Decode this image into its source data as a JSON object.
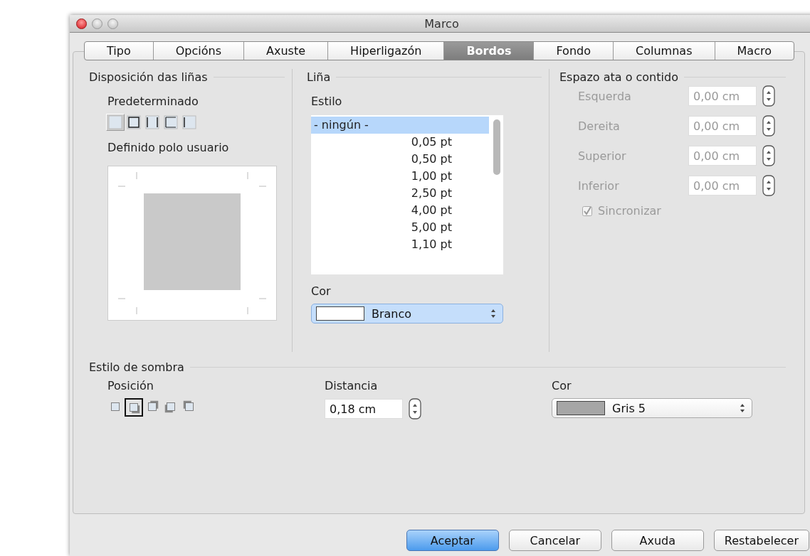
{
  "window": {
    "title": "Marco"
  },
  "tabs": [
    {
      "label": "Tipo",
      "selected": false
    },
    {
      "label": "Opcións",
      "selected": false
    },
    {
      "label": "Axuste",
      "selected": false
    },
    {
      "label": "Hiperligazón",
      "selected": false
    },
    {
      "label": "Bordos",
      "selected": true
    },
    {
      "label": "Fondo",
      "selected": false
    },
    {
      "label": "Columnas",
      "selected": false
    },
    {
      "label": "Macro",
      "selected": false
    }
  ],
  "line_arrangement": {
    "title": "Disposición das liñas",
    "default_label": "Predeterminado",
    "presets": [
      {
        "kind": "none",
        "selected": true
      },
      {
        "kind": "box",
        "selected": false
      },
      {
        "kind": "left-right",
        "selected": false
      },
      {
        "kind": "top-bottom",
        "selected": false
      },
      {
        "kind": "left",
        "selected": false
      }
    ],
    "user_label": "Definido polo usuario"
  },
  "line": {
    "title": "Liña",
    "style_label": "Estilo",
    "styles": [
      {
        "label": "- ningún -",
        "selected": true
      },
      {
        "label": "0,05 pt",
        "selected": false
      },
      {
        "label": "0,50 pt",
        "selected": false
      },
      {
        "label": "1,00 pt",
        "selected": false
      },
      {
        "label": "2,50 pt",
        "selected": false
      },
      {
        "label": "4,00 pt",
        "selected": false
      },
      {
        "label": "5,00 pt",
        "selected": false
      },
      {
        "label": "1,10 pt",
        "selected": false
      }
    ],
    "color_label": "Cor",
    "color": {
      "value": "Branco",
      "color": "#ffffff"
    }
  },
  "spacing": {
    "title": "Espazo ata o contido",
    "disabled": true,
    "fields": [
      {
        "label": "Esquerda",
        "value": "0,00 cm"
      },
      {
        "label": "Dereita",
        "value": "0,00 cm"
      },
      {
        "label": "Superior",
        "value": "0,00 cm"
      },
      {
        "label": "Inferior",
        "value": "0,00 cm"
      }
    ],
    "sync": {
      "label": "Sincronizar",
      "checked": true
    }
  },
  "shadow": {
    "title": "Estilo de sombra",
    "position_label": "Posición",
    "positions": [
      {
        "kind": "none",
        "selected": false
      },
      {
        "kind": "bottom-right",
        "selected": true
      },
      {
        "kind": "top-right",
        "selected": false
      },
      {
        "kind": "bottom-left",
        "selected": false
      },
      {
        "kind": "top-left",
        "selected": false
      }
    ],
    "distance_label": "Distancia",
    "distance": "0,18 cm",
    "color_label": "Cor",
    "color": {
      "value": "Gris 5",
      "color": "#a6a6a6"
    }
  },
  "buttons": [
    {
      "label": "Aceptar",
      "default": true
    },
    {
      "label": "Cancelar",
      "default": false
    },
    {
      "label": "Axuda",
      "default": false
    },
    {
      "label": "Restabelecer",
      "default": false
    }
  ]
}
